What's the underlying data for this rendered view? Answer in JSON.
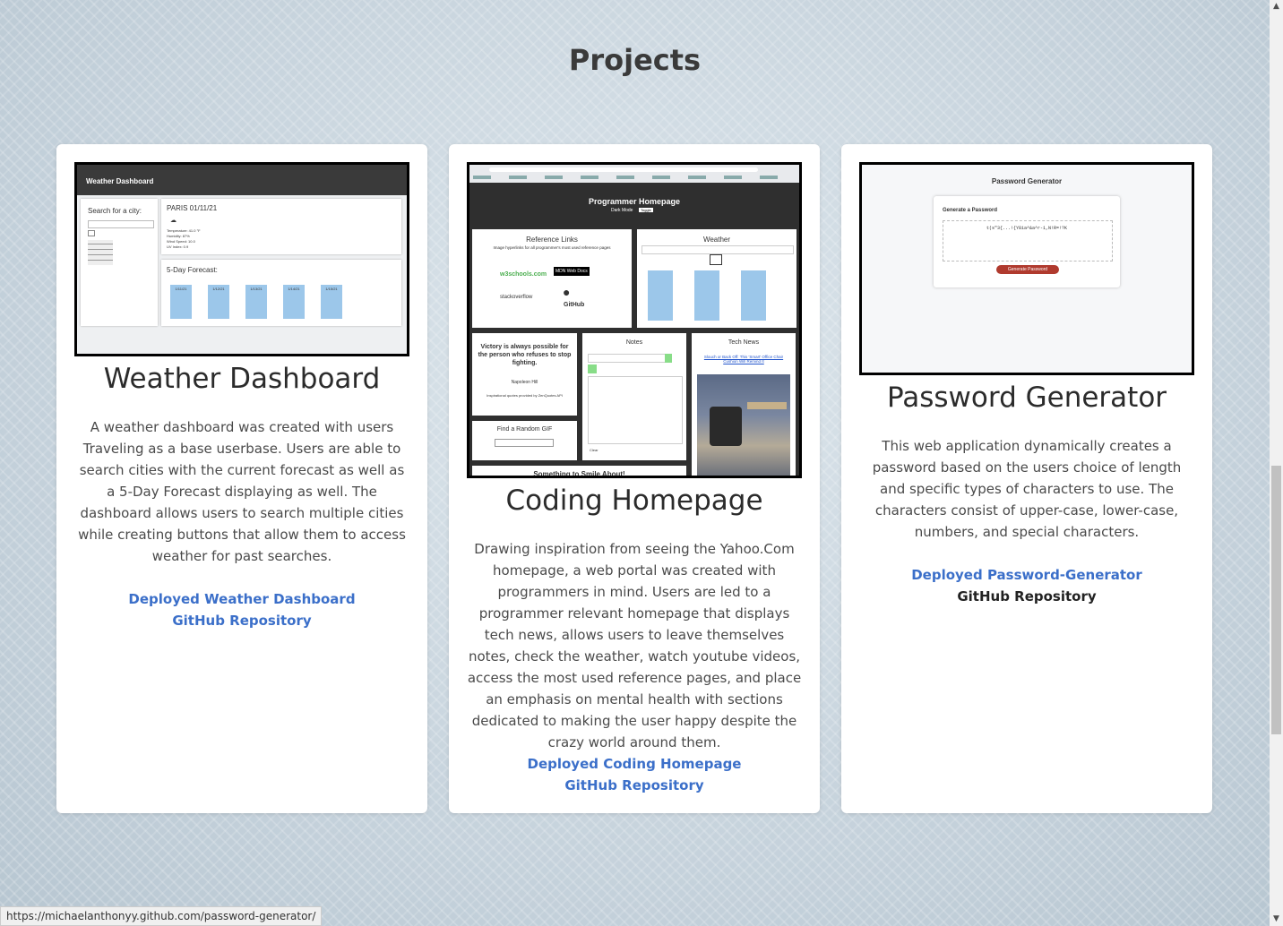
{
  "section_title": "Projects",
  "cards": [
    {
      "title": "Weather Dashboard",
      "description": "A weather dashboard was created with users Traveling as a base userbase. Users are able to search cities with the current forecast as well as a 5-Day Forecast displaying as well. The dashboard allows users to search multiple cities while creating buttons that allow them to access weather for past searches.",
      "links": [
        "Deployed Weather Dashboard",
        "GitHub Repository"
      ],
      "thumb": {
        "header": "Weather Dashboard",
        "search_label": "Search for a city:",
        "city": "PARIS 01/11/21",
        "stats": [
          "Temperature: 41.0 °F",
          "Humidity: 87%",
          "Wind Speed: 10.0",
          "UV Index: 0.9"
        ],
        "forecast_label": "5-Day Forecast:",
        "days": [
          "1/11/21",
          "1/12/21",
          "1/13/21",
          "1/14/21",
          "1/15/21"
        ]
      }
    },
    {
      "title": "Coding Homepage",
      "description": "Drawing inspiration from seeing the Yahoo.Com homepage, a web portal was created with programmers in mind. Users are led to a programmer relevant homepage that displays tech news, allows users to leave themselves notes, check the weather, watch youtube videos, access the most used reference pages, and place an emphasis on mental health with sections dedicated to making the user happy despite the crazy world around them.",
      "links": [
        "Deployed Coding Homepage",
        "GitHub Repository"
      ],
      "thumb": {
        "header": "Programmer Homepage",
        "dark_mode": "Dark Mode",
        "toggle": "Toggle",
        "reference": "Reference Links",
        "reference_sub": "Image hyperlinks for all programmer's most used reference pages",
        "w3": "w3schools.com",
        "mdn": "MDN Web Docs",
        "so": "stackoverflow",
        "github": "GitHub",
        "weather": "Weather",
        "quote": "Victory is always possible for the person who refuses to stop fighting.",
        "quote_author": "Napoleon Hill",
        "quote_credit": "Inspirational quotes provided by ZenQuotes API",
        "notes": "Notes",
        "clear": "Clear",
        "tech_news": "Tech News",
        "news_link": "Slouch or Back Off: This 'Smart' Office Chair Cushion Will Remind It",
        "gif": "Find a Random GIF",
        "smile": "Something to Smile About!"
      }
    },
    {
      "title": "Password Generator",
      "description": "This web application dynamically creates a password based on the users choice of length and specific types of characters to use. The characters consist of upper-case, lower-case, numbers, and special characters.",
      "links": [
        "Deployed Password-Generator",
        "GitHub Repository"
      ],
      "thumb": {
        "header": "Password Generator",
        "sub": "Generate a Password",
        "password": "t(s\"3{...!{Y8ia^&a^r-1,N!R=!?K",
        "button": "Generate Password"
      }
    }
  ],
  "status_url": "https://michaelanthonyy.github.com/password-generator/",
  "colors": {
    "link": "#3b6fc9",
    "visited_link": "#222222",
    "button": "#c0392b"
  }
}
